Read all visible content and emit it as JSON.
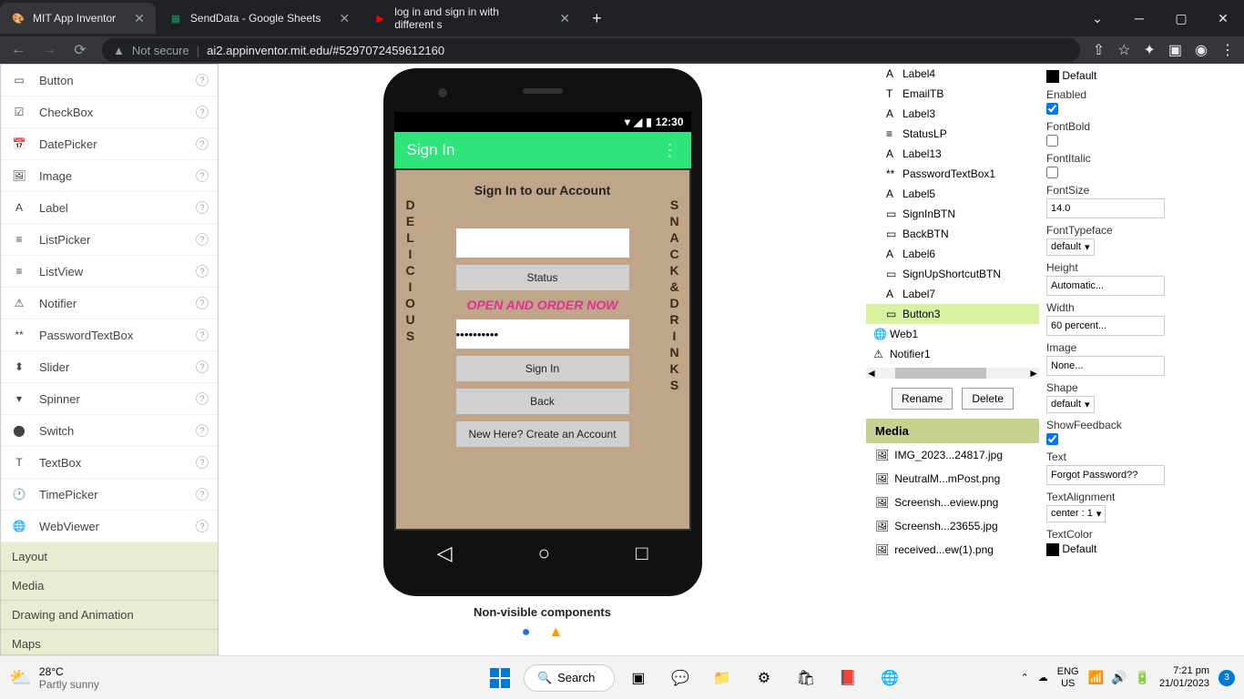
{
  "browser": {
    "tabs": [
      {
        "title": "MIT App Inventor",
        "favicon": "🎨",
        "active": true
      },
      {
        "title": "SendData - Google Sheets",
        "favicon": "📗",
        "active": false
      },
      {
        "title": "log in and sign in with different s",
        "favicon": "▶",
        "active": false
      }
    ],
    "url_prefix": "Not secure",
    "url": "ai2.appinventor.mit.edu/#5297072459612160"
  },
  "palette": {
    "items": [
      "Button",
      "CheckBox",
      "DatePicker",
      "Image",
      "Label",
      "ListPicker",
      "ListView",
      "Notifier",
      "PasswordTextBox",
      "Slider",
      "Spinner",
      "Switch",
      "TextBox",
      "TimePicker",
      "WebViewer"
    ],
    "groups": [
      "Layout",
      "Media",
      "Drawing and Animation",
      "Maps"
    ]
  },
  "phone": {
    "status_time": "12:30",
    "app_title": "Sign In",
    "content": {
      "title": "Sign In to our Account",
      "status_btn": "Status",
      "banner": "OPEN AND ORDER NOW",
      "sign_in_btn": "Sign In",
      "back_btn": "Back",
      "signup_btn": "New Here? Create an Account",
      "side_left": "DELICIOUS",
      "side_right": "SNACK&DRINKS"
    },
    "nonvisible_label": "Non-visible components",
    "nonvisible_items": [
      "Web1",
      "Notifier1"
    ]
  },
  "components": {
    "items": [
      {
        "name": "Label4",
        "icon": "A"
      },
      {
        "name": "EmailTB",
        "icon": "T"
      },
      {
        "name": "Label3",
        "icon": "A"
      },
      {
        "name": "StatusLP",
        "icon": "≡"
      },
      {
        "name": "Label13",
        "icon": "A"
      },
      {
        "name": "PasswordTextBox1",
        "icon": "**"
      },
      {
        "name": "Label5",
        "icon": "A"
      },
      {
        "name": "SignInBTN",
        "icon": "▭"
      },
      {
        "name": "BackBTN",
        "icon": "▭"
      },
      {
        "name": "Label6",
        "icon": "A"
      },
      {
        "name": "SignUpShortcutBTN",
        "icon": "▭"
      },
      {
        "name": "Label7",
        "icon": "A"
      },
      {
        "name": "Button3",
        "icon": "▭",
        "selected": true
      },
      {
        "name": "Web1",
        "icon": "🌐",
        "root": true
      },
      {
        "name": "Notifier1",
        "icon": "⚠",
        "root": true
      }
    ],
    "rename": "Rename",
    "delete": "Delete"
  },
  "media": {
    "header": "Media",
    "items": [
      "IMG_2023...24817.jpg",
      "NeutralM...mPost.png",
      "Screensh...eview.png",
      "Screensh...23655.jpg",
      "received...ew(1).png"
    ]
  },
  "properties": {
    "default_label": "Default",
    "enabled": {
      "label": "Enabled",
      "checked": true
    },
    "fontbold": {
      "label": "FontBold",
      "checked": false
    },
    "fontitalic": {
      "label": "FontItalic",
      "checked": false
    },
    "fontsize": {
      "label": "FontSize",
      "value": "14.0"
    },
    "fonttypeface": {
      "label": "FontTypeface",
      "value": "default"
    },
    "height": {
      "label": "Height",
      "value": "Automatic..."
    },
    "width": {
      "label": "Width",
      "value": "60 percent..."
    },
    "image": {
      "label": "Image",
      "value": "None..."
    },
    "shape": {
      "label": "Shape",
      "value": "default"
    },
    "showfeedback": {
      "label": "ShowFeedback",
      "checked": true
    },
    "text": {
      "label": "Text",
      "value": "Forgot Password??"
    },
    "textalignment": {
      "label": "TextAlignment",
      "value": "center : 1"
    },
    "textcolor": {
      "label": "TextColor",
      "value": "Default"
    }
  },
  "taskbar": {
    "temp": "28°C",
    "weather": "Partly sunny",
    "search": "Search",
    "lang1": "ENG",
    "lang2": "US",
    "time": "7:21 pm",
    "date": "21/01/2023",
    "notif": "3"
  }
}
